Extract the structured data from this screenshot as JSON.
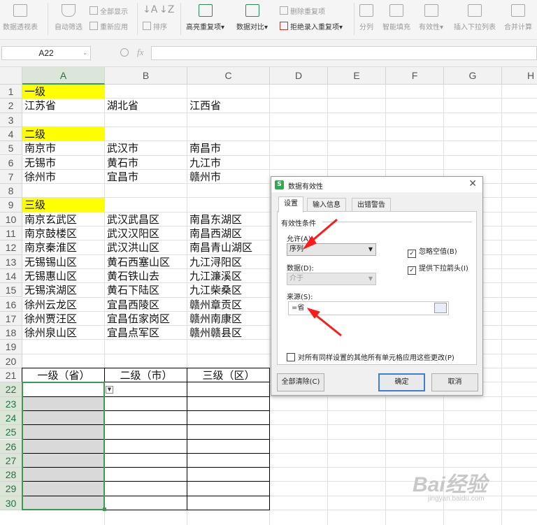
{
  "ribbon": {
    "items": [
      {
        "label": "数据透视表",
        "enabled": false
      },
      {
        "label": "自动筛选",
        "enabled": false
      },
      {
        "label": "全部显示",
        "enabled": false
      },
      {
        "label": "重新应用",
        "enabled": false
      },
      {
        "label": "排序",
        "enabled": false
      },
      {
        "label": "高亮重复项",
        "enabled": true
      },
      {
        "label": "数据对比",
        "enabled": true
      },
      {
        "label": "删除重复项",
        "enabled": false
      },
      {
        "label": "拒绝录入重复项",
        "enabled": true
      },
      {
        "label": "分列",
        "enabled": false
      },
      {
        "label": "智能填充",
        "enabled": false
      },
      {
        "label": "有效性",
        "enabled": false
      },
      {
        "label": "插入下拉列表",
        "enabled": false
      },
      {
        "label": "合并计算",
        "enabled": false
      }
    ]
  },
  "formula_bar": {
    "name_box": "A22",
    "fx": "fx",
    "formula": ""
  },
  "grid": {
    "columns": [
      "A",
      "B",
      "C",
      "D",
      "E",
      "F",
      "G",
      "H"
    ],
    "selected_column": "A",
    "rows": [
      "1",
      "2",
      "3",
      "4",
      "5",
      "6",
      "7",
      "8",
      "9",
      "10",
      "11",
      "12",
      "13",
      "14",
      "15",
      "16",
      "17",
      "18",
      "19",
      "20",
      "21",
      "22",
      "23",
      "24",
      "25",
      "26",
      "27",
      "28",
      "29",
      "30"
    ],
    "selected_rows_from": 22,
    "cells": {
      "A1": "一级",
      "A2": "江苏省",
      "B2": "湖北省",
      "C2": "江西省",
      "A4": "二级",
      "A5": "南京市",
      "B5": "武汉市",
      "C5": "南昌市",
      "A6": "无锡市",
      "B6": "黄石市",
      "C6": "九江市",
      "A7": "徐州市",
      "B7": "宜昌市",
      "C7": "赣州市",
      "A9": "三级",
      "A10": "南京玄武区",
      "B10": "武汉武昌区",
      "C10": "南昌东湖区",
      "A11": "南京鼓楼区",
      "B11": "武汉汉阳区",
      "C11": "南昌西湖区",
      "A12": "南京秦淮区",
      "B12": "武汉洪山区",
      "C12": "南昌青山湖区",
      "A13": "无锡锡山区",
      "B13": "黄石西塞山区",
      "C13": "九江浔阳区",
      "A14": "无锡惠山区",
      "B14": "黄石铁山去",
      "C14": "九江濂溪区",
      "A15": "无锡滨湖区",
      "B15": "黄石下陆区",
      "C15": "九江柴桑区",
      "A16": "徐州云龙区",
      "B16": "宜昌西陵区",
      "C16": "赣州章贡区",
      "A17": "徐州贾汪区",
      "B17": "宜昌伍家岗区",
      "C17": "赣州南康区",
      "A18": "徐州泉山区",
      "B18": "宜昌点军区",
      "C18": "赣州赣县区",
      "A21": "一级（省）",
      "B21": "二级（市）",
      "C21": "三级（区）"
    },
    "highlight_color": "#ffff00"
  },
  "dialog": {
    "title": "数据有效性",
    "app_icon": "S",
    "tabs": [
      "设置",
      "输入信息",
      "出错警告"
    ],
    "active_tab": 0,
    "section": "有效性条件",
    "allow_label": "允许(A):",
    "allow_value": "序列",
    "data_label": "数据(D):",
    "data_value": "介于",
    "ignore_blank": {
      "label": "忽略空值(B)",
      "checked": true
    },
    "dropdown_arrow": {
      "label": "提供下拉箭头(I)",
      "checked": true
    },
    "source_label": "来源(S):",
    "source_value": "=省",
    "apply_all": {
      "label": "对所有同样设置的其他所有单元格应用这些更改(P)",
      "checked": false
    },
    "clear_button": "全部清除(C)",
    "ok_button": "确定",
    "cancel_button": "取消"
  },
  "watermark": {
    "text": "Bai经验",
    "sub": "jingyan.baidu.com"
  },
  "colors": {
    "accent": "#3c9a55",
    "arrow": "#ff1a1a",
    "default_button": "#3c7fd8"
  }
}
